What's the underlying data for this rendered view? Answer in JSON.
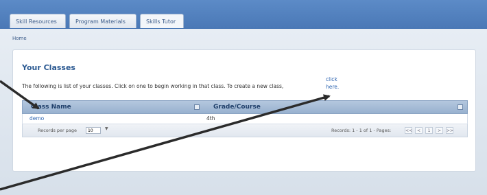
{
  "tabs": [
    {
      "label": "Skill Resources"
    },
    {
      "label": "Program Materials"
    },
    {
      "label": "Skills Tutor"
    }
  ],
  "breadcrumb": "Home",
  "page": {
    "heading": "Your Classes",
    "description": "The following is list of your classes. Click on one to begin working in that class. To create a new class,",
    "create_link_line1": "click",
    "create_link_line2": "here."
  },
  "table": {
    "headers": [
      "Class Name",
      "Grade/Course"
    ],
    "rows": [
      {
        "class_name": "demo",
        "grade": "4th"
      }
    ],
    "footer": {
      "records_per_page_label": "Records per page",
      "records_per_page_value": "10",
      "records_info": "Records: 1 - 1 of 1 - Pages:",
      "buttons": [
        "<<",
        "<",
        "1",
        ">",
        ">>"
      ]
    }
  },
  "annotation_color": "#2b2b2b"
}
